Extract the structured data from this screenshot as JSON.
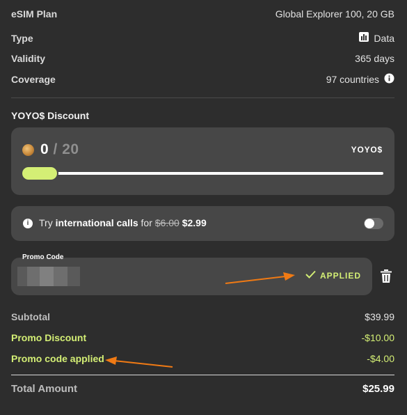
{
  "plan": {
    "esim_plan_label": "eSIM Plan",
    "esim_plan_value": "Global Explorer 100, 20 GB",
    "type_label": "Type",
    "type_value": "Data",
    "validity_label": "Validity",
    "validity_value": "365 days",
    "coverage_label": "Coverage",
    "coverage_value": "97 countries"
  },
  "yoyo": {
    "section_title": "YOYO$ Discount",
    "current": "0",
    "separator": "/",
    "max": "20",
    "unit": "YOYO$",
    "slider_value": 0
  },
  "intl": {
    "prefix": "Try",
    "feature": "international calls",
    "mid": "for",
    "old_price": "$6.00",
    "new_price": "$2.99",
    "toggle_on": false
  },
  "promo": {
    "label": "Promo Code",
    "status": "APPLIED"
  },
  "summary": {
    "subtotal_label": "Subtotal",
    "subtotal_value": "$39.99",
    "promo_discount_label": "Promo Discount",
    "promo_discount_value": "-$10.00",
    "promo_applied_label": "Promo code applied",
    "promo_applied_value": "-$4.00",
    "total_label": "Total Amount",
    "total_value": "$25.99"
  },
  "colors": {
    "background": "#2d2d2d",
    "card": "#474747",
    "accent_green": "#d4ef75",
    "annotation_arrow": "#f07a14"
  },
  "icons": {
    "type": "bar-chart-icon",
    "coverage": "info-icon",
    "yoyo": "coin-icon",
    "intl": "info-icon",
    "applied": "checkmark-icon",
    "delete": "trash-icon"
  }
}
